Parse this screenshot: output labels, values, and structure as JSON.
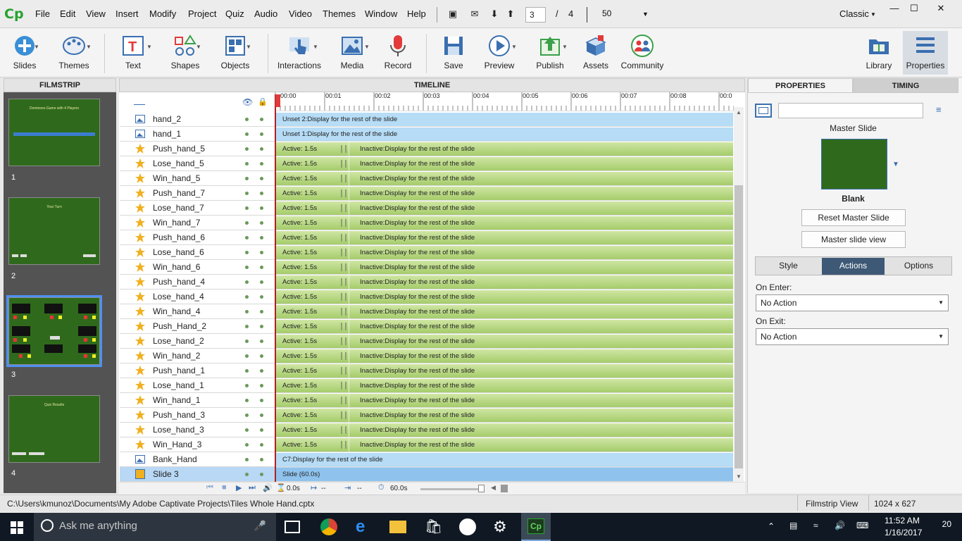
{
  "menubar": {
    "logo": "Cp",
    "items": [
      "File",
      "Edit",
      "View",
      "Insert",
      "Modify",
      "Project",
      "Quiz",
      "Audio",
      "Video",
      "Themes",
      "Window",
      "Help"
    ],
    "page_current": "3",
    "page_sep": "/",
    "page_total": "4",
    "zoom": "50",
    "workspace": "Classic"
  },
  "toolbar": {
    "slides": "Slides",
    "themes": "Themes",
    "text": "Text",
    "shapes": "Shapes",
    "objects": "Objects",
    "interactions": "Interactions",
    "media": "Media",
    "record": "Record",
    "save": "Save",
    "preview": "Preview",
    "publish": "Publish",
    "assets": "Assets",
    "community": "Community",
    "library": "Library",
    "properties": "Properties"
  },
  "filmstrip": {
    "header": "FILMSTRIP",
    "slides": [
      {
        "num": "1",
        "title": "Dominoes Game with 4 Players"
      },
      {
        "num": "2",
        "title": "Your Turn"
      },
      {
        "num": "3",
        "title": ""
      },
      {
        "num": "4",
        "title": "Quiz Results"
      }
    ]
  },
  "timeline": {
    "header": "TIMELINE",
    "ticks": [
      "00:00",
      "00:01",
      "00:02",
      "00:03",
      "00:04",
      "00:05",
      "00:06",
      "00:07",
      "00:08",
      "00:0"
    ],
    "rows": [
      {
        "name": "hand_2",
        "type": "image",
        "bar": "blue",
        "label": "Unset 2:Display for the rest of the slide"
      },
      {
        "name": "hand_1",
        "type": "image",
        "bar": "blue",
        "label": "Unset 1:Display for the rest of the slide"
      },
      {
        "name": "Push_hand_5",
        "type": "star",
        "bar": "green",
        "active": "Active: 1.5s",
        "inactive": "Inactive:Display for the rest of the slide"
      },
      {
        "name": "Lose_hand_5",
        "type": "star",
        "bar": "green",
        "active": "Active: 1.5s",
        "inactive": "Inactive:Display for the rest of the slide"
      },
      {
        "name": "Win_hand_5",
        "type": "star",
        "bar": "green",
        "active": "Active: 1.5s",
        "inactive": "Inactive:Display for the rest of the slide"
      },
      {
        "name": "Push_hand_7",
        "type": "star",
        "bar": "green",
        "active": "Active: 1.5s",
        "inactive": "Inactive:Display for the rest of the slide"
      },
      {
        "name": "Lose_hand_7",
        "type": "star",
        "bar": "green",
        "active": "Active: 1.5s",
        "inactive": "Inactive:Display for the rest of the slide"
      },
      {
        "name": "Win_hand_7",
        "type": "star",
        "bar": "green",
        "active": "Active: 1.5s",
        "inactive": "Inactive:Display for the rest of the slide"
      },
      {
        "name": "Push_hand_6",
        "type": "star",
        "bar": "green",
        "active": "Active: 1.5s",
        "inactive": "Inactive:Display for the rest of the slide"
      },
      {
        "name": "Lose_hand_6",
        "type": "star",
        "bar": "green",
        "active": "Active: 1.5s",
        "inactive": "Inactive:Display for the rest of the slide"
      },
      {
        "name": "Win_hand_6",
        "type": "star",
        "bar": "green",
        "active": "Active: 1.5s",
        "inactive": "Inactive:Display for the rest of the slide"
      },
      {
        "name": "Push_hand_4",
        "type": "star",
        "bar": "green",
        "active": "Active: 1.5s",
        "inactive": "Inactive:Display for the rest of the slide"
      },
      {
        "name": "Lose_hand_4",
        "type": "star",
        "bar": "green",
        "active": "Active: 1.5s",
        "inactive": "Inactive:Display for the rest of the slide"
      },
      {
        "name": "Win_hand_4",
        "type": "star",
        "bar": "green",
        "active": "Active: 1.5s",
        "inactive": "Inactive:Display for the rest of the slide"
      },
      {
        "name": "Push_Hand_2",
        "type": "star",
        "bar": "green",
        "active": "Active: 1.5s",
        "inactive": "Inactive:Display for the rest of the slide"
      },
      {
        "name": "Lose_hand_2",
        "type": "star",
        "bar": "green",
        "active": "Active: 1.5s",
        "inactive": "Inactive:Display for the rest of the slide"
      },
      {
        "name": "Win_hand_2",
        "type": "star",
        "bar": "green",
        "active": "Active: 1.5s",
        "inactive": "Inactive:Display for the rest of the slide"
      },
      {
        "name": "Push_hand_1",
        "type": "star",
        "bar": "green",
        "active": "Active: 1.5s",
        "inactive": "Inactive:Display for the rest of the slide"
      },
      {
        "name": "Lose_hand_1",
        "type": "star",
        "bar": "green",
        "active": "Active: 1.5s",
        "inactive": "Inactive:Display for the rest of the slide"
      },
      {
        "name": "Win_hand_1",
        "type": "star",
        "bar": "green",
        "active": "Active: 1.5s",
        "inactive": "Inactive:Display for the rest of the slide"
      },
      {
        "name": "Push_hand_3",
        "type": "star",
        "bar": "green",
        "active": "Active: 1.5s",
        "inactive": "Inactive:Display for the rest of the slide"
      },
      {
        "name": "Lose_hand_3",
        "type": "star",
        "bar": "green",
        "active": "Active: 1.5s",
        "inactive": "Inactive:Display for the rest of the slide"
      },
      {
        "name": "Win_Hand_3",
        "type": "star",
        "bar": "green",
        "active": "Active: 1.5s",
        "inactive": "Inactive:Display for the rest of the slide"
      },
      {
        "name": "Bank_Hand",
        "type": "image",
        "bar": "blue",
        "label": "C7:Display for the rest of the slide"
      },
      {
        "name": "Slide 3",
        "type": "slide",
        "bar": "slide",
        "label": "Slide (60.0s)"
      }
    ],
    "footer": {
      "start": "0.0s",
      "in": "--",
      "out": "--",
      "duration": "60.0s"
    }
  },
  "properties": {
    "tab_properties": "PROPERTIES",
    "tab_timing": "TIMING",
    "name_value": "",
    "master_slide_label": "Master Slide",
    "master_name": "Blank",
    "reset_button": "Reset Master Slide",
    "view_button": "Master slide view",
    "seg_style": "Style",
    "seg_actions": "Actions",
    "seg_options": "Options",
    "on_enter_label": "On Enter:",
    "on_enter_value": "No Action",
    "on_exit_label": "On Exit:",
    "on_exit_value": "No Action"
  },
  "status": {
    "path": "C:\\Users\\kmunoz\\Documents\\My Adobe Captivate Projects\\Tiles Whole Hand.cptx",
    "view": "Filmstrip View",
    "size": "1024 x 627"
  },
  "taskbar": {
    "search_placeholder": "Ask me anything",
    "time": "11:52 AM",
    "date": "1/16/2017",
    "notifications": "20"
  },
  "colors": {
    "accent": "#27a32e",
    "selection": "#4f8ff2",
    "timeline_green": "#a5cc6a",
    "timeline_blue": "#b6dcf6",
    "playhead": "#b02020"
  }
}
